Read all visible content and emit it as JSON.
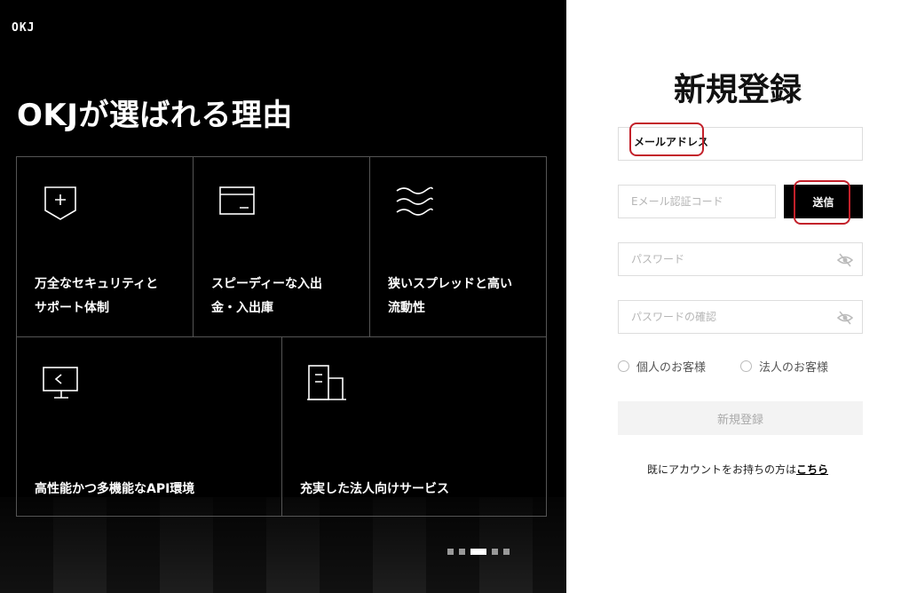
{
  "brand": {
    "logo": "OKJ"
  },
  "hero": {
    "title": "OKJが選ばれる理由"
  },
  "features": [
    {
      "icon": "shield-plus-icon",
      "line1": "万全なセキュリティと",
      "line2": "サポート体制"
    },
    {
      "icon": "card-icon",
      "line1": "スピーディーな入出",
      "line2": "金・入出庫"
    },
    {
      "icon": "waves-icon",
      "line1": "狭いスプレッドと高い",
      "line2": "流動性"
    },
    {
      "icon": "monitor-icon",
      "line1": "高性能かつ多機能なAPI環境",
      "line2": ""
    },
    {
      "icon": "building-icon",
      "line1": "充実した法人向けサービス",
      "line2": ""
    }
  ],
  "carousel": {
    "active_index": 2,
    "count": 5
  },
  "form": {
    "title": "新規登録",
    "email_label": "メールアドレス",
    "code_placeholder": "Eメール認証コード",
    "send_label": "送信",
    "password_placeholder": "パスワード",
    "password_confirm_placeholder": "パスワードの確認",
    "radio_individual": "個人のお客様",
    "radio_corporate": "法人のお客様",
    "submit_label": "新規登録",
    "login_prompt": "既にアカウントをお持ちの方は",
    "login_link": "こちら"
  },
  "colors": {
    "annotation": "#c3202a",
    "panel": "#000000"
  }
}
